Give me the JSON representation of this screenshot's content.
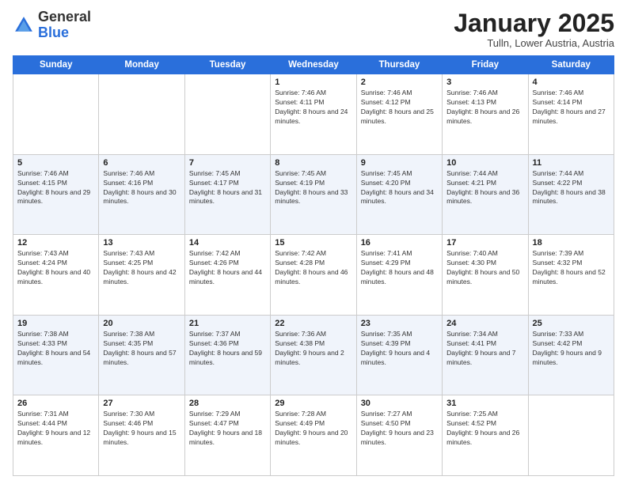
{
  "header": {
    "logo_line1": "General",
    "logo_line2": "Blue",
    "month": "January 2025",
    "location": "Tulln, Lower Austria, Austria"
  },
  "weekdays": [
    "Sunday",
    "Monday",
    "Tuesday",
    "Wednesday",
    "Thursday",
    "Friday",
    "Saturday"
  ],
  "weeks": [
    [
      {
        "day": "",
        "sunrise": "",
        "sunset": "",
        "daylight": ""
      },
      {
        "day": "",
        "sunrise": "",
        "sunset": "",
        "daylight": ""
      },
      {
        "day": "",
        "sunrise": "",
        "sunset": "",
        "daylight": ""
      },
      {
        "day": "1",
        "sunrise": "Sunrise: 7:46 AM",
        "sunset": "Sunset: 4:11 PM",
        "daylight": "Daylight: 8 hours and 24 minutes."
      },
      {
        "day": "2",
        "sunrise": "Sunrise: 7:46 AM",
        "sunset": "Sunset: 4:12 PM",
        "daylight": "Daylight: 8 hours and 25 minutes."
      },
      {
        "day": "3",
        "sunrise": "Sunrise: 7:46 AM",
        "sunset": "Sunset: 4:13 PM",
        "daylight": "Daylight: 8 hours and 26 minutes."
      },
      {
        "day": "4",
        "sunrise": "Sunrise: 7:46 AM",
        "sunset": "Sunset: 4:14 PM",
        "daylight": "Daylight: 8 hours and 27 minutes."
      }
    ],
    [
      {
        "day": "5",
        "sunrise": "Sunrise: 7:46 AM",
        "sunset": "Sunset: 4:15 PM",
        "daylight": "Daylight: 8 hours and 29 minutes."
      },
      {
        "day": "6",
        "sunrise": "Sunrise: 7:46 AM",
        "sunset": "Sunset: 4:16 PM",
        "daylight": "Daylight: 8 hours and 30 minutes."
      },
      {
        "day": "7",
        "sunrise": "Sunrise: 7:45 AM",
        "sunset": "Sunset: 4:17 PM",
        "daylight": "Daylight: 8 hours and 31 minutes."
      },
      {
        "day": "8",
        "sunrise": "Sunrise: 7:45 AM",
        "sunset": "Sunset: 4:19 PM",
        "daylight": "Daylight: 8 hours and 33 minutes."
      },
      {
        "day": "9",
        "sunrise": "Sunrise: 7:45 AM",
        "sunset": "Sunset: 4:20 PM",
        "daylight": "Daylight: 8 hours and 34 minutes."
      },
      {
        "day": "10",
        "sunrise": "Sunrise: 7:44 AM",
        "sunset": "Sunset: 4:21 PM",
        "daylight": "Daylight: 8 hours and 36 minutes."
      },
      {
        "day": "11",
        "sunrise": "Sunrise: 7:44 AM",
        "sunset": "Sunset: 4:22 PM",
        "daylight": "Daylight: 8 hours and 38 minutes."
      }
    ],
    [
      {
        "day": "12",
        "sunrise": "Sunrise: 7:43 AM",
        "sunset": "Sunset: 4:24 PM",
        "daylight": "Daylight: 8 hours and 40 minutes."
      },
      {
        "day": "13",
        "sunrise": "Sunrise: 7:43 AM",
        "sunset": "Sunset: 4:25 PM",
        "daylight": "Daylight: 8 hours and 42 minutes."
      },
      {
        "day": "14",
        "sunrise": "Sunrise: 7:42 AM",
        "sunset": "Sunset: 4:26 PM",
        "daylight": "Daylight: 8 hours and 44 minutes."
      },
      {
        "day": "15",
        "sunrise": "Sunrise: 7:42 AM",
        "sunset": "Sunset: 4:28 PM",
        "daylight": "Daylight: 8 hours and 46 minutes."
      },
      {
        "day": "16",
        "sunrise": "Sunrise: 7:41 AM",
        "sunset": "Sunset: 4:29 PM",
        "daylight": "Daylight: 8 hours and 48 minutes."
      },
      {
        "day": "17",
        "sunrise": "Sunrise: 7:40 AM",
        "sunset": "Sunset: 4:30 PM",
        "daylight": "Daylight: 8 hours and 50 minutes."
      },
      {
        "day": "18",
        "sunrise": "Sunrise: 7:39 AM",
        "sunset": "Sunset: 4:32 PM",
        "daylight": "Daylight: 8 hours and 52 minutes."
      }
    ],
    [
      {
        "day": "19",
        "sunrise": "Sunrise: 7:38 AM",
        "sunset": "Sunset: 4:33 PM",
        "daylight": "Daylight: 8 hours and 54 minutes."
      },
      {
        "day": "20",
        "sunrise": "Sunrise: 7:38 AM",
        "sunset": "Sunset: 4:35 PM",
        "daylight": "Daylight: 8 hours and 57 minutes."
      },
      {
        "day": "21",
        "sunrise": "Sunrise: 7:37 AM",
        "sunset": "Sunset: 4:36 PM",
        "daylight": "Daylight: 8 hours and 59 minutes."
      },
      {
        "day": "22",
        "sunrise": "Sunrise: 7:36 AM",
        "sunset": "Sunset: 4:38 PM",
        "daylight": "Daylight: 9 hours and 2 minutes."
      },
      {
        "day": "23",
        "sunrise": "Sunrise: 7:35 AM",
        "sunset": "Sunset: 4:39 PM",
        "daylight": "Daylight: 9 hours and 4 minutes."
      },
      {
        "day": "24",
        "sunrise": "Sunrise: 7:34 AM",
        "sunset": "Sunset: 4:41 PM",
        "daylight": "Daylight: 9 hours and 7 minutes."
      },
      {
        "day": "25",
        "sunrise": "Sunrise: 7:33 AM",
        "sunset": "Sunset: 4:42 PM",
        "daylight": "Daylight: 9 hours and 9 minutes."
      }
    ],
    [
      {
        "day": "26",
        "sunrise": "Sunrise: 7:31 AM",
        "sunset": "Sunset: 4:44 PM",
        "daylight": "Daylight: 9 hours and 12 minutes."
      },
      {
        "day": "27",
        "sunrise": "Sunrise: 7:30 AM",
        "sunset": "Sunset: 4:46 PM",
        "daylight": "Daylight: 9 hours and 15 minutes."
      },
      {
        "day": "28",
        "sunrise": "Sunrise: 7:29 AM",
        "sunset": "Sunset: 4:47 PM",
        "daylight": "Daylight: 9 hours and 18 minutes."
      },
      {
        "day": "29",
        "sunrise": "Sunrise: 7:28 AM",
        "sunset": "Sunset: 4:49 PM",
        "daylight": "Daylight: 9 hours and 20 minutes."
      },
      {
        "day": "30",
        "sunrise": "Sunrise: 7:27 AM",
        "sunset": "Sunset: 4:50 PM",
        "daylight": "Daylight: 9 hours and 23 minutes."
      },
      {
        "day": "31",
        "sunrise": "Sunrise: 7:25 AM",
        "sunset": "Sunset: 4:52 PM",
        "daylight": "Daylight: 9 hours and 26 minutes."
      },
      {
        "day": "",
        "sunrise": "",
        "sunset": "",
        "daylight": ""
      }
    ]
  ]
}
